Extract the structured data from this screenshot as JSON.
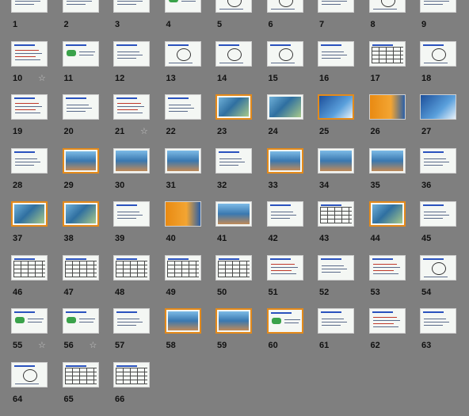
{
  "slide_sorter": {
    "slides": [
      {
        "n": "1",
        "style": "plain",
        "sel": false,
        "star": false
      },
      {
        "n": "2",
        "style": "plain",
        "sel": false,
        "star": false
      },
      {
        "n": "3",
        "style": "plain",
        "sel": false,
        "star": false
      },
      {
        "n": "4",
        "style": "green",
        "sel": false,
        "star": false
      },
      {
        "n": "5",
        "style": "diagram",
        "sel": false,
        "star": false
      },
      {
        "n": "6",
        "style": "diagram",
        "sel": false,
        "star": false
      },
      {
        "n": "7",
        "style": "plain",
        "sel": false,
        "star": false
      },
      {
        "n": "8",
        "style": "diagram",
        "sel": false,
        "star": false
      },
      {
        "n": "9",
        "style": "plain",
        "sel": false,
        "star": false
      },
      {
        "n": "10",
        "style": "red",
        "sel": false,
        "star": true
      },
      {
        "n": "11",
        "style": "green",
        "sel": false,
        "star": false
      },
      {
        "n": "12",
        "style": "plain",
        "sel": false,
        "star": false
      },
      {
        "n": "13",
        "style": "diagram",
        "sel": false,
        "star": false
      },
      {
        "n": "14",
        "style": "diagram",
        "sel": false,
        "star": false
      },
      {
        "n": "15",
        "style": "diagram",
        "sel": false,
        "star": false
      },
      {
        "n": "16",
        "style": "plain",
        "sel": false,
        "star": false
      },
      {
        "n": "17",
        "style": "table",
        "sel": false,
        "star": false
      },
      {
        "n": "18",
        "style": "diagram",
        "sel": false,
        "star": false
      },
      {
        "n": "19",
        "style": "red",
        "sel": false,
        "star": false
      },
      {
        "n": "20",
        "style": "plain",
        "sel": false,
        "star": false
      },
      {
        "n": "21",
        "style": "red",
        "sel": false,
        "star": true
      },
      {
        "n": "22",
        "style": "plain",
        "sel": false,
        "star": false
      },
      {
        "n": "23",
        "style": "photo",
        "sel": true,
        "star": false
      },
      {
        "n": "24",
        "style": "photo",
        "sel": false,
        "star": false
      },
      {
        "n": "25",
        "style": "blue",
        "sel": true,
        "star": false
      },
      {
        "n": "26",
        "style": "orange",
        "sel": false,
        "star": false
      },
      {
        "n": "27",
        "style": "blue",
        "sel": false,
        "star": false
      },
      {
        "n": "28",
        "style": "plain",
        "sel": false,
        "star": false
      },
      {
        "n": "29",
        "style": "people",
        "sel": true,
        "star": false
      },
      {
        "n": "30",
        "style": "people",
        "sel": false,
        "star": false
      },
      {
        "n": "31",
        "style": "people",
        "sel": false,
        "star": false
      },
      {
        "n": "32",
        "style": "plain",
        "sel": false,
        "star": false
      },
      {
        "n": "33",
        "style": "people",
        "sel": true,
        "star": false
      },
      {
        "n": "34",
        "style": "people",
        "sel": false,
        "star": false
      },
      {
        "n": "35",
        "style": "people",
        "sel": false,
        "star": false
      },
      {
        "n": "36",
        "style": "plain",
        "sel": false,
        "star": false
      },
      {
        "n": "37",
        "style": "photo",
        "sel": true,
        "star": false
      },
      {
        "n": "38",
        "style": "photo",
        "sel": true,
        "star": false
      },
      {
        "n": "39",
        "style": "plain",
        "sel": false,
        "star": false
      },
      {
        "n": "40",
        "style": "orange",
        "sel": false,
        "star": false
      },
      {
        "n": "41",
        "style": "people",
        "sel": false,
        "star": false
      },
      {
        "n": "42",
        "style": "plain",
        "sel": false,
        "star": false
      },
      {
        "n": "43",
        "style": "table",
        "sel": false,
        "star": false
      },
      {
        "n": "44",
        "style": "photo",
        "sel": true,
        "star": false
      },
      {
        "n": "45",
        "style": "plain",
        "sel": false,
        "star": false
      },
      {
        "n": "46",
        "style": "table",
        "sel": false,
        "star": false
      },
      {
        "n": "47",
        "style": "table",
        "sel": false,
        "star": false
      },
      {
        "n": "48",
        "style": "table",
        "sel": false,
        "star": false
      },
      {
        "n": "49",
        "style": "table",
        "sel": false,
        "star": false
      },
      {
        "n": "50",
        "style": "table",
        "sel": false,
        "star": false
      },
      {
        "n": "51",
        "style": "red",
        "sel": false,
        "star": false
      },
      {
        "n": "52",
        "style": "plain",
        "sel": false,
        "star": false
      },
      {
        "n": "53",
        "style": "red",
        "sel": false,
        "star": false
      },
      {
        "n": "54",
        "style": "diagram",
        "sel": false,
        "star": false
      },
      {
        "n": "55",
        "style": "green",
        "sel": false,
        "star": true
      },
      {
        "n": "56",
        "style": "green",
        "sel": false,
        "star": true
      },
      {
        "n": "57",
        "style": "plain",
        "sel": false,
        "star": false
      },
      {
        "n": "58",
        "style": "people",
        "sel": true,
        "star": false
      },
      {
        "n": "59",
        "style": "people",
        "sel": true,
        "star": false
      },
      {
        "n": "60",
        "style": "green",
        "sel": true,
        "star": false
      },
      {
        "n": "61",
        "style": "plain",
        "sel": false,
        "star": false
      },
      {
        "n": "62",
        "style": "red",
        "sel": false,
        "star": false
      },
      {
        "n": "63",
        "style": "plain",
        "sel": false,
        "star": false
      },
      {
        "n": "64",
        "style": "diagram",
        "sel": false,
        "star": false
      },
      {
        "n": "65",
        "style": "table",
        "sel": false,
        "star": false
      },
      {
        "n": "66",
        "style": "table",
        "sel": false,
        "star": false
      }
    ],
    "star_glyph": "☆",
    "colors": {
      "background": "#7f7f7f",
      "selected_border": "#e48a1a"
    }
  }
}
